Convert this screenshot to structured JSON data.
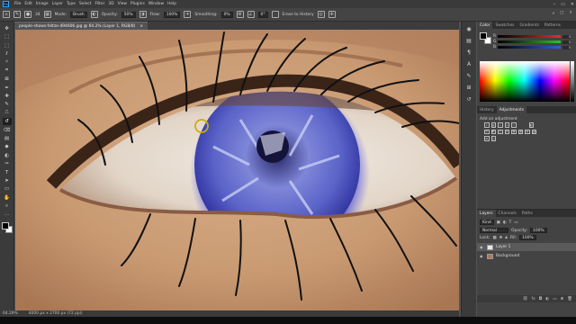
{
  "app": {
    "logo": "Ps"
  },
  "menu": [
    "File",
    "Edit",
    "Image",
    "Layer",
    "Type",
    "Select",
    "Filter",
    "3D",
    "View",
    "Plugins",
    "Window",
    "Help"
  ],
  "options_bar": {
    "mode_label": "Mode:",
    "mode_value": "Brush",
    "opacity_label": "Opacity:",
    "opacity_value": "50%",
    "flow_label": "Flow:",
    "flow_value": "100%",
    "smoothing_label": "Smoothing:",
    "smoothing_value": "0%",
    "angle_value": "0°",
    "erase_history_label": "Erase to History",
    "brush_size": "34"
  },
  "document": {
    "tab_title": "people-shows-feltze-494606.jpg @ 64.2% (Layer 1, RGB/8)",
    "close_glyph": "×"
  },
  "status": {
    "zoom": "64.29%",
    "info": "4000 px x 2700 px (72 ppi)"
  },
  "color_panel": {
    "tabs": [
      "Color",
      "Swatches",
      "Gradients",
      "Patterns"
    ],
    "active_tab": "Color",
    "sliders": [
      {
        "label": "R",
        "value": "0",
        "color": "#e03030"
      },
      {
        "label": "G",
        "value": "0",
        "color": "#30c030"
      },
      {
        "label": "B",
        "value": "0",
        "color": "#3060e0"
      }
    ]
  },
  "adjustments_panel": {
    "tabs": [
      "History",
      "Adjustments"
    ],
    "active_tab": "Adjustments",
    "hint": "Add an adjustment",
    "icon_rows": 3
  },
  "layers_panel": {
    "tabs": [
      "Layers",
      "Channels",
      "Paths"
    ],
    "active_tab": "Layers",
    "filter_label": "Kind",
    "blend_mode": "Normal",
    "opacity_label": "Opacity:",
    "opacity_value": "100%",
    "lock_label": "Lock:",
    "fill_label": "Fill:",
    "fill_value": "100%",
    "layers": [
      {
        "name": "Layer 1",
        "selected": true
      },
      {
        "name": "Background",
        "selected": false
      }
    ]
  },
  "tools": [
    "move-icon",
    "artboard-icon",
    "marquee-icon",
    "lasso-icon",
    "quick-select-icon",
    "crop-icon",
    "frame-icon",
    "eyedropper-icon",
    "healing-icon",
    "brush-icon",
    "clone-stamp-icon",
    "history-brush-icon",
    "eraser-icon",
    "gradient-icon",
    "blur-icon",
    "dodge-icon",
    "pen-icon",
    "type-icon",
    "path-select-icon",
    "rectangle-icon",
    "hand-icon",
    "zoom-icon",
    "more-tools-icon"
  ],
  "active_tool_index": 11
}
